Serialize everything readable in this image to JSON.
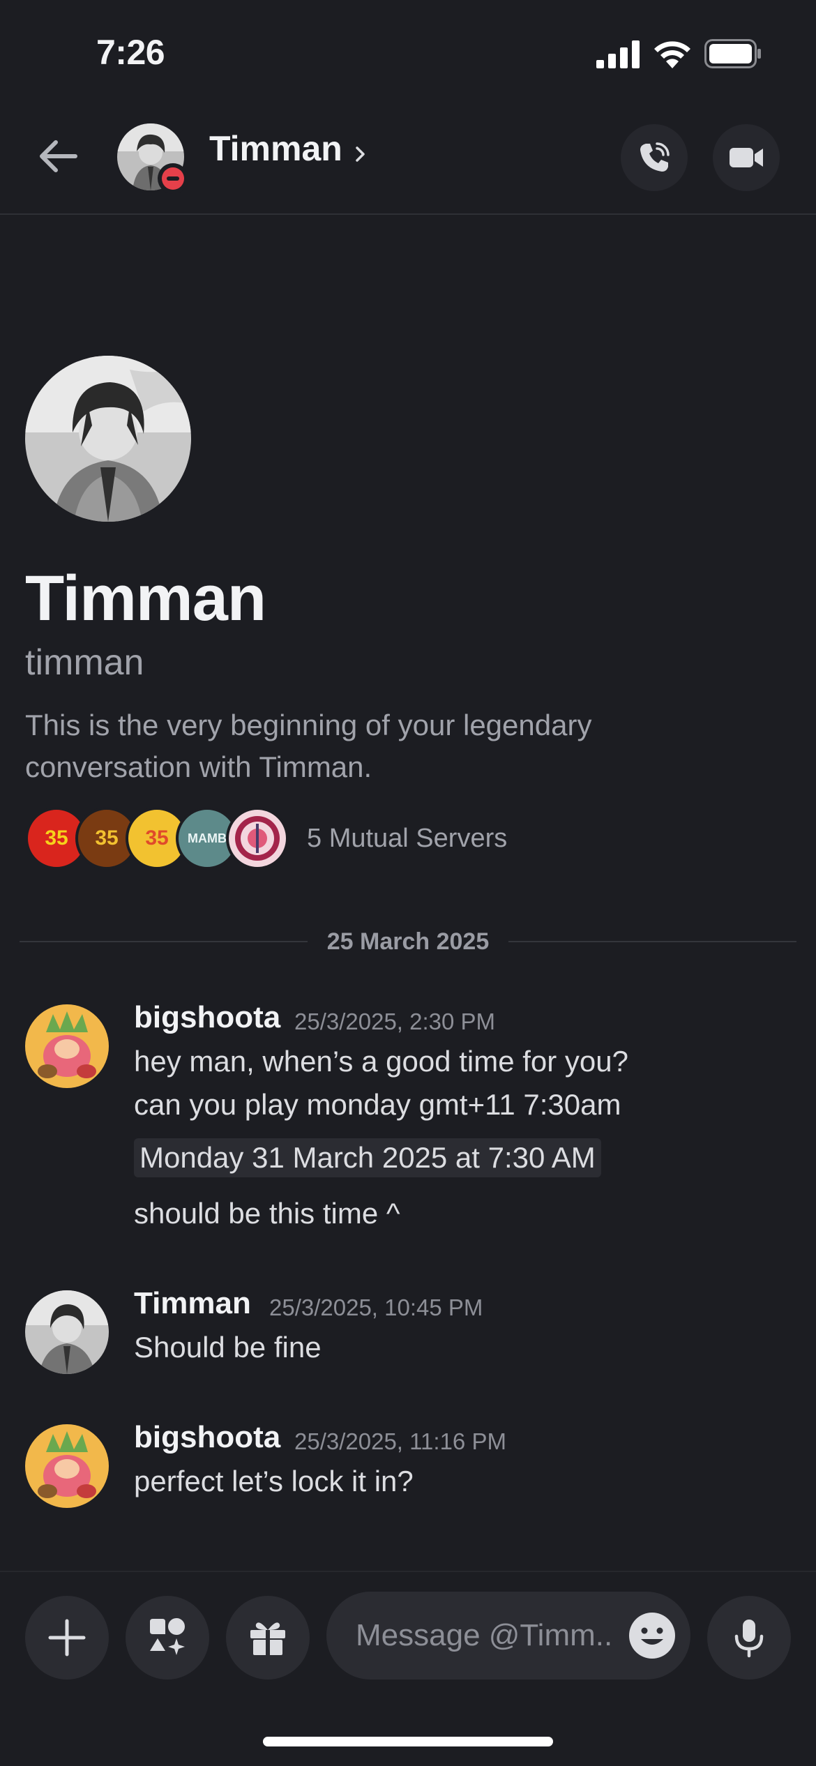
{
  "status_bar": {
    "time": "7:26"
  },
  "header": {
    "name": "Timman"
  },
  "intro": {
    "display_name": "Timman",
    "username": "timman",
    "description": "This is the very beginning of your legendary conversation with Timman.",
    "mutual_servers_label": "5 Mutual Servers",
    "server_icons": [
      {
        "text": "35",
        "bg": "#d9251d"
      },
      {
        "text": "35",
        "bg": "#7a3b12"
      },
      {
        "text": "35",
        "bg": "#f2c230"
      },
      {
        "text": "MAMB",
        "bg": "#5d8a8a"
      },
      {
        "text": "",
        "bg": "#f3d6de"
      }
    ]
  },
  "divider": {
    "date": "25 March 2025"
  },
  "messages": [
    {
      "author": "bigshoota",
      "time": "25/3/2025, 2:30 PM",
      "lines": [
        "hey man, when’s a good time for you?",
        "can you play monday gmt+11 7:30am"
      ],
      "timestamp_chip": "Monday 31 March 2025 at 7:30 AM",
      "after_chip": "should be this time ^"
    },
    {
      "author": "Timman",
      "time": "25/3/2025, 10:45 PM",
      "lines": [
        "Should be fine"
      ]
    },
    {
      "author": "bigshoota",
      "time": "25/3/2025, 11:16 PM",
      "lines": [
        "perfect let’s lock it in?"
      ]
    }
  ],
  "composer": {
    "placeholder": "Message @Timm..."
  },
  "colors": {
    "background": "#1c1d22",
    "dnd": "#e5404a",
    "muted_text": "#a1a3ab"
  }
}
